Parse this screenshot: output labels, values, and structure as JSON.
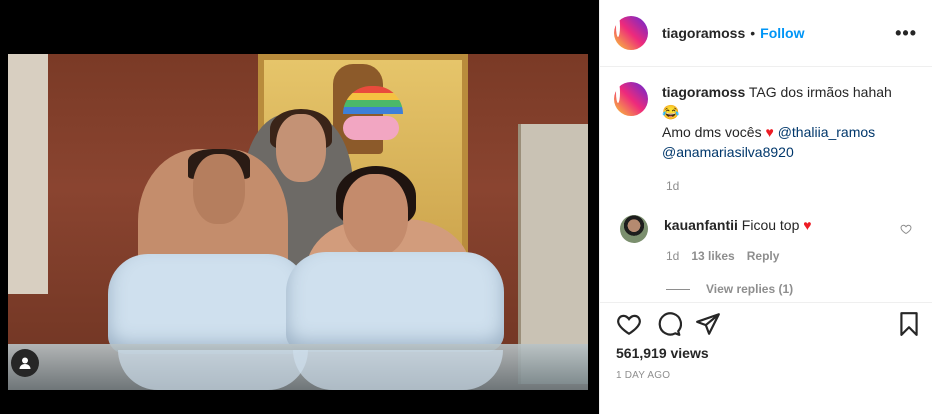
{
  "post": {
    "username": "tiagoramoss",
    "separator": "•",
    "follow_label": "Follow",
    "more_label": "•••"
  },
  "caption": {
    "username": "tiagoramoss",
    "line1": "TAG dos irmãos hahah",
    "emoji1": "😂",
    "line2_text": "Amo dms vocês",
    "heart": "♥",
    "mention1": "@thaliia_ramos",
    "mention2": "@anamariasilva8920",
    "time": "1d"
  },
  "comment": {
    "username": "kauanfantii",
    "text": "Ficou top",
    "heart": "♥",
    "time": "1d",
    "likes": "13 likes",
    "reply_label": "Reply",
    "view_replies": "View replies (1)"
  },
  "stats": {
    "views": "561,919 views",
    "posted": "1 DAY AGO"
  },
  "icons": [
    "heart-icon",
    "comment-icon",
    "share-icon",
    "bookmark-icon",
    "user-tag-icon",
    "more-options-icon"
  ],
  "colors": {
    "link": "#0095f6",
    "mention": "#00376b",
    "heart": "#ed1c24",
    "muted": "#8e8e8e"
  }
}
